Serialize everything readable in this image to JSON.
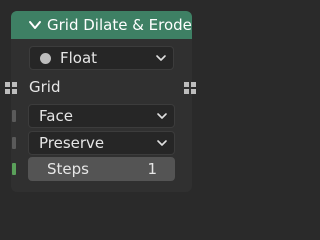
{
  "node": {
    "title": "Grid Dilate & Erode",
    "header_color": "#3e8064",
    "data_type": {
      "value": "Float",
      "icon": "dot-icon"
    },
    "output_socket": {
      "label": "Grid",
      "icon": "grid-socket-icon"
    },
    "connectivity": {
      "value": "Face",
      "socket_color": "#5a5a5a"
    },
    "tiling": {
      "value": "Preserve",
      "socket_color": "#5a5a5a"
    },
    "steps": {
      "label": "Steps",
      "value": "1",
      "socket_color": "#5aa05a"
    }
  }
}
